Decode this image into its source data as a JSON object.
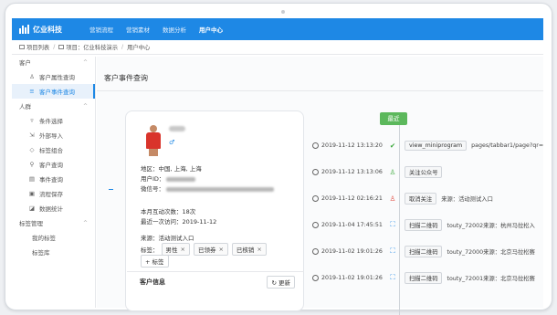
{
  "brand": {
    "name": "亿业科技"
  },
  "nav": [
    {
      "label": "营销流程",
      "active": false
    },
    {
      "label": "营销素材",
      "active": false
    },
    {
      "label": "数据分析",
      "active": false
    },
    {
      "label": "用户中心",
      "active": true
    }
  ],
  "breadcrumb": [
    "项目列表",
    "项目：亿业科技演示",
    "用户中心"
  ],
  "sidebar": {
    "sections": [
      {
        "title": "客户",
        "items": [
          {
            "label": "客户属性查询",
            "icon": "user-icon",
            "active": false
          },
          {
            "label": "客户事件查询",
            "icon": "list-icon",
            "active": true
          }
        ]
      },
      {
        "title": "人群",
        "items": [
          {
            "label": "条件选择",
            "icon": "filter-icon",
            "active": false
          },
          {
            "label": "外部导入",
            "icon": "import-icon",
            "active": false
          },
          {
            "label": "标签组合",
            "icon": "tag-icon",
            "active": false
          },
          {
            "label": "客户查询",
            "icon": "search-icon",
            "active": false
          },
          {
            "label": "事件查询",
            "icon": "event-icon",
            "active": false
          },
          {
            "label": "流程保存",
            "icon": "save-icon",
            "active": false
          },
          {
            "label": "数据统计",
            "icon": "chart-icon",
            "active": false
          }
        ]
      },
      {
        "title": "标签管理",
        "items": [
          {
            "label": "我的标签",
            "icon": "",
            "active": false
          },
          {
            "label": "标签库",
            "icon": "",
            "active": false
          }
        ]
      }
    ]
  },
  "page": {
    "title": "客户事件查询"
  },
  "profile": {
    "region_label": "地区：",
    "region_value": "中国, 上海, 上海",
    "userid_label": "用户ID：",
    "wechat_label": "微信号：",
    "interactions_label": "本月互动次数：",
    "interactions_value": "18次",
    "last_visit_label": "最近一次访问：",
    "last_visit_value": "2019-11-12",
    "source_label": "来源：",
    "source_value": "活动测试入口",
    "tags_label": "标签：",
    "tags": [
      "男性",
      "已领券",
      "已核销"
    ],
    "add_tag_label": "+ 标签",
    "customer_info_label": "客户信息",
    "refresh_label": "更新"
  },
  "timeline": {
    "latest_label": "最近",
    "events": [
      {
        "time": "2019-11-12 13:13:20",
        "icon": "check-circle-icon",
        "color": "#3aa83a",
        "badge": "view_miniprogram",
        "text": "pages/tabbar1/page?qr="
      },
      {
        "time": "2019-11-12 13:13:06",
        "icon": "user-add-icon",
        "color": "#3aa83a",
        "badge": "关注公众号",
        "text": ""
      },
      {
        "time": "2019-11-12 02:16:21",
        "icon": "user-remove-icon",
        "color": "#e0453a",
        "badge": "取消关注",
        "text": "来源：活动测试入口"
      },
      {
        "time": "2019-11-04 17:45:51",
        "icon": "scan-icon",
        "color": "#1e88e5",
        "badge": "扫描二维码",
        "text": "touty_72002来源：杭州马拉松入"
      },
      {
        "time": "2019-11-02 19:01:26",
        "icon": "scan-icon",
        "color": "#1e88e5",
        "badge": "扫描二维码",
        "text": "touty_72000来源：北京马拉松赛"
      },
      {
        "time": "2019-11-02 19:01:26",
        "icon": "scan-icon",
        "color": "#1e88e5",
        "badge": "扫描二维码",
        "text": "touty_72001来源：北京马拉松赛"
      }
    ]
  }
}
